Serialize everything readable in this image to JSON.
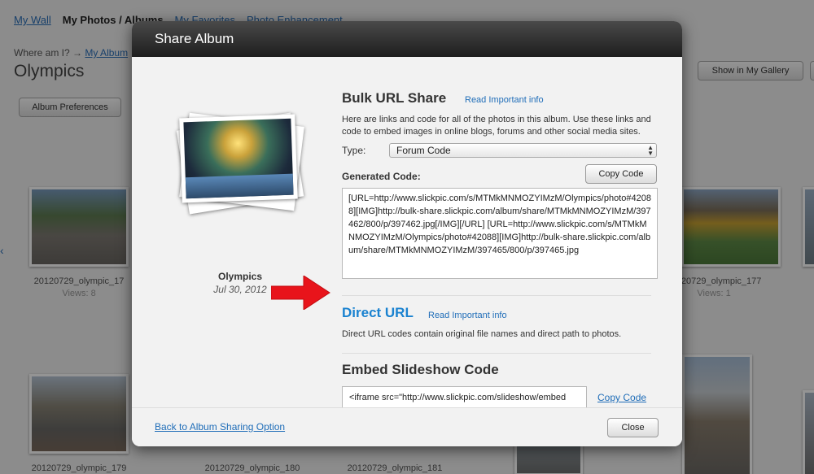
{
  "background": {
    "nav": {
      "my_wall": "My Wall",
      "my_photos": "My Photos",
      "sep": "/",
      "albums": "Albums",
      "favorites": "My Favorites",
      "enhancement": "Photo Enhancement"
    },
    "breadcrumb": {
      "label": "Where am I?",
      "arrow": "→",
      "link": "My Album"
    },
    "title": "Olympics",
    "album_prefs": "Album Preferences",
    "show_gallery": "Show in My Gallery",
    "thumbs": [
      {
        "label": "20120729_olympic_17",
        "views": "Views: 8"
      },
      {
        "label": "20120729_olympic_177",
        "views": "Views: 1"
      },
      {
        "label": "20120729_olympic_179",
        "views": ""
      },
      {
        "label": "20120729_olympic_180",
        "views": ""
      },
      {
        "label": "20120729_olympic_181",
        "views": ""
      }
    ]
  },
  "modal": {
    "title": "Share Album",
    "album": {
      "name": "Olympics",
      "date": "Jul 30, 2012"
    },
    "bulk": {
      "title": "Bulk URL Share",
      "info_link": "Read Important info",
      "description": "Here are links and code for all of the photos in this album. Use these links and code to embed images in online blogs, forums and other social media sites.",
      "type_label": "Type:",
      "type_value": "Forum Code",
      "generated_label": "Generated Code:",
      "copy_button": "Copy Code",
      "code": "[URL=http://www.slickpic.com/s/MTMkMNMOZYIMzM/Olympics/photo#42088][IMG]http://bulk-share.slickpic.com/album/share/MTMkMNMOZYIMzM/397462/800/p/397462.jpg[/IMG][/URL] [URL=http://www.slickpic.com/s/MTMkMNMOZYIMzM/Olympics/photo#42088][IMG]http://bulk-share.slickpic.com/album/share/MTMkMNMOZYIMzM/397465/800/p/397465.jpg"
    },
    "direct": {
      "title": "Direct URL",
      "info_link": "Read Important info",
      "description": "Direct URL codes contain original file names and direct path to photos."
    },
    "embed": {
      "title": "Embed Slideshow Code",
      "value": "<iframe src=\"http://www.slickpic.com/slideshow/embed",
      "copy_link": "Copy Code"
    },
    "footer": {
      "back_link": "Back to Album Sharing Option",
      "close": "Close"
    }
  },
  "colors": {
    "link": "#1f6db8",
    "direct_title": "#1a82d0",
    "arrow": "#e8141b",
    "header_dark": "#1e1e1e"
  }
}
